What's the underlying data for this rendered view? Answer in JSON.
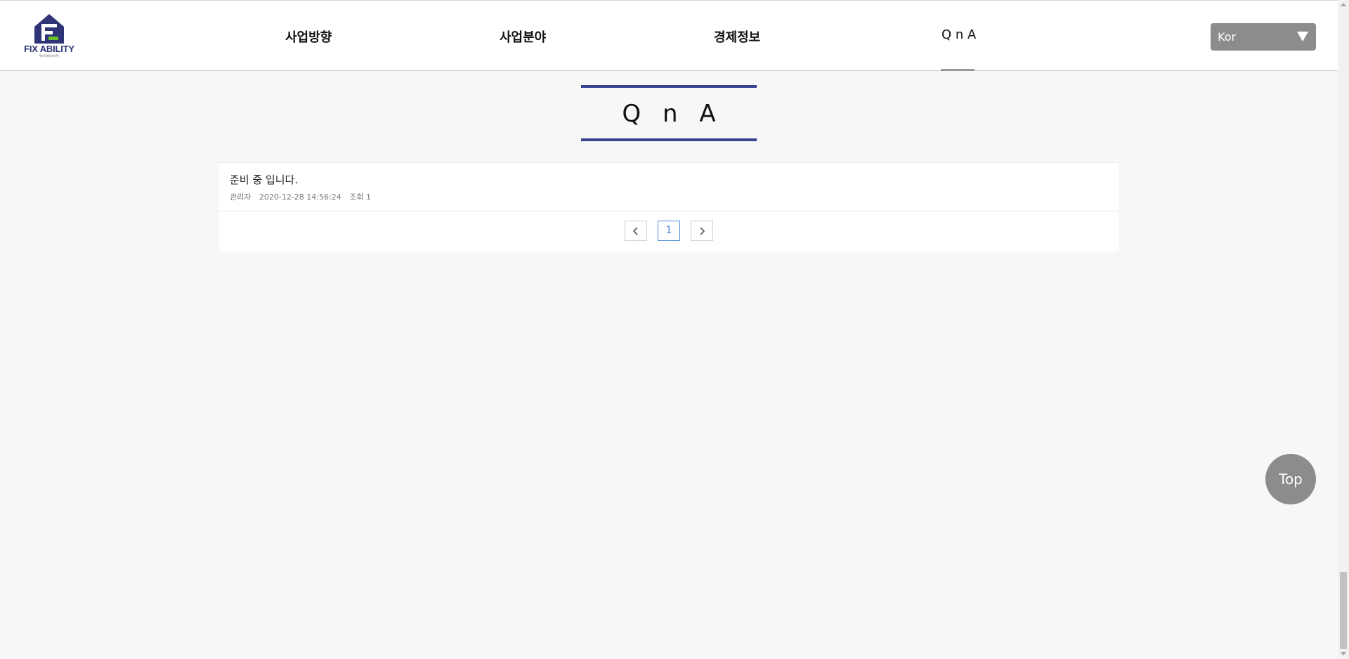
{
  "brand": {
    "name": "FIX ABILITY",
    "tagline": "픽스어빌리티(주)",
    "colors": {
      "navy": "#2f3477",
      "green": "#6abf2a",
      "title_bar": "#3a4290"
    }
  },
  "nav": {
    "items": [
      {
        "label": "사업방향"
      },
      {
        "label": "사업분야"
      },
      {
        "label": "경제정보"
      },
      {
        "label": "Q n A",
        "active": true
      }
    ]
  },
  "language": {
    "selected": "Kor",
    "icon": "caret-down-icon"
  },
  "page": {
    "title": "Q n A"
  },
  "board": {
    "posts": [
      {
        "title": "준비 중 입니다.",
        "author": "관리자",
        "date": "2020-12-28 14:56:24",
        "views_label": "조회 1"
      }
    ],
    "pagination": {
      "prev_icon": "chevron-left-icon",
      "next_icon": "chevron-right-icon",
      "pages": [
        "1"
      ],
      "current": "1"
    }
  },
  "top_button": {
    "label": "Top"
  }
}
